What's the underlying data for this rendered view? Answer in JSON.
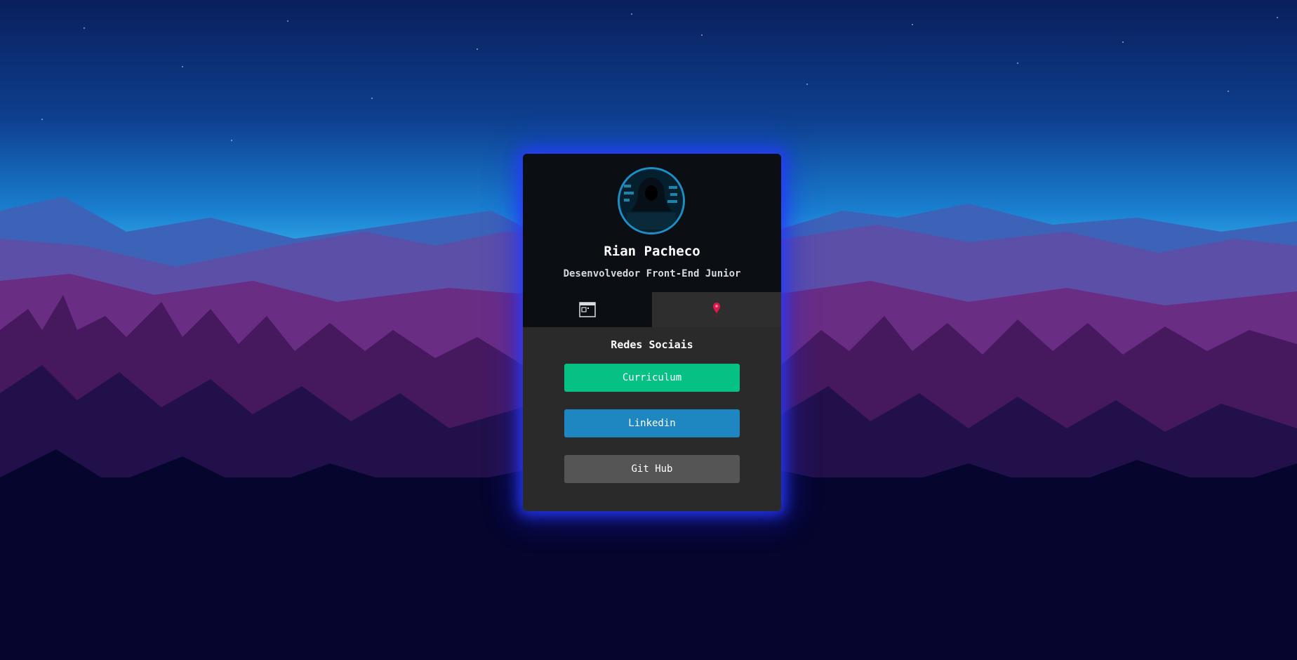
{
  "profile": {
    "name": "Rian Pacheco",
    "role": "Desenvolvedor Front-End Junior"
  },
  "tabs": [
    {
      "icon": "terminal-window-icon",
      "active": false
    },
    {
      "icon": "location-pin-icon",
      "active": true
    }
  ],
  "social": {
    "title": "Redes Sociais",
    "buttons": [
      {
        "label": "Curriculum",
        "color": "#06c184"
      },
      {
        "label": "Linkedin",
        "color": "#1e86c0"
      },
      {
        "label": "Git Hub",
        "color": "#555555"
      }
    ]
  },
  "colors": {
    "card_glow": "#2a3cff",
    "card_header": "#0b0e12",
    "card_body": "#2a2a2a",
    "pin": "#d81b4b"
  }
}
